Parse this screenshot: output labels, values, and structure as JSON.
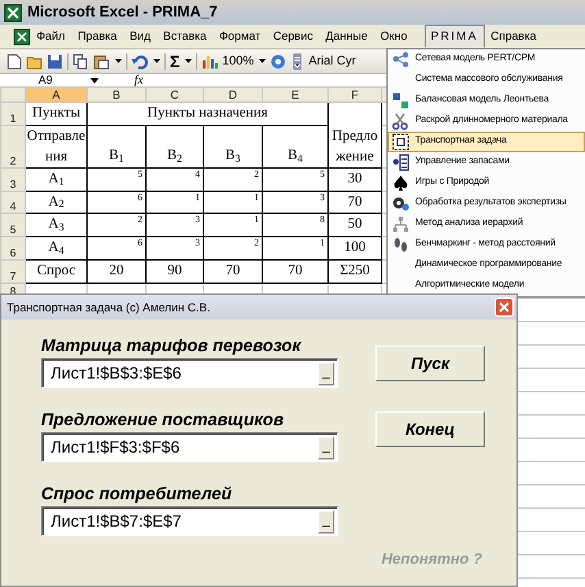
{
  "window": {
    "title": "Microsoft Excel - PRIMA_7"
  },
  "menu": [
    {
      "label": "Файл",
      "selected": false
    },
    {
      "label": "Правка",
      "selected": false
    },
    {
      "label": "Вид",
      "selected": false
    },
    {
      "label": "Вставка",
      "selected": false
    },
    {
      "label": "Формат",
      "selected": false
    },
    {
      "label": "Сервис",
      "selected": false
    },
    {
      "label": "Данные",
      "selected": false
    },
    {
      "label": "Окно",
      "selected": false
    },
    {
      "label": "PRIMA",
      "selected": true
    },
    {
      "label": "Справка",
      "selected": false
    }
  ],
  "toolbar": {
    "sum": "Σ",
    "zoom": "100%",
    "font": "Arial Cyr"
  },
  "formula_bar": {
    "cell": "A9",
    "fx": "fx"
  },
  "sheet": {
    "columns": [
      {
        "label": "A",
        "selected": true
      },
      {
        "label": "B",
        "selected": false
      },
      {
        "label": "C",
        "selected": false
      },
      {
        "label": "D",
        "selected": false
      },
      {
        "label": "E",
        "selected": false
      },
      {
        "label": "F",
        "selected": false
      }
    ],
    "row_numbers": [
      "1",
      "2",
      "3",
      "4",
      "5",
      "6",
      "7",
      "8"
    ],
    "corner_top": "Пункты",
    "corner_bottom": "Отправления",
    "destinations_title": "Пункты назначения",
    "supply_title": "Предложение",
    "destinations": [
      "B$_{1}$",
      "B$_{2}$",
      "B$_{3}$",
      "B$_{4}$"
    ],
    "sources": [
      {
        "name": "A$_{1}$",
        "costs": [
          "5",
          "4",
          "2",
          "5"
        ],
        "supply": "30"
      },
      {
        "name": "A$_{2}$",
        "costs": [
          "6",
          "1",
          "1",
          "3"
        ],
        "supply": "70"
      },
      {
        "name": "A$_{3}$",
        "costs": [
          "2",
          "3",
          "1",
          "8"
        ],
        "supply": "50"
      },
      {
        "name": "A$_{4}$",
        "costs": [
          "6",
          "3",
          "2",
          "1"
        ],
        "supply": "100"
      }
    ],
    "demand": {
      "label": "Спрос",
      "values": [
        "20",
        "90",
        "70",
        "70"
      ],
      "total": "Σ250"
    }
  },
  "prima_menu": {
    "items": [
      {
        "label": "Сетевая модель PERT/CPM",
        "selected": false
      },
      {
        "label": "Система массового обслуживания",
        "selected": false
      },
      {
        "label": "Балансовая модель Леонтьева",
        "selected": false
      },
      {
        "label": "Раскрой длинномерного материала",
        "selected": false
      },
      {
        "label": "Транспортная задача",
        "selected": true
      },
      {
        "label": "Управление запасами",
        "selected": false
      },
      {
        "label": "Игры с Природой",
        "selected": false
      },
      {
        "label": "Обработка результатов экспертизы",
        "selected": false
      },
      {
        "label": "Метод анализа иерархий",
        "selected": false
      },
      {
        "label": "Бенчмаркинг - метод расстояний",
        "selected": false
      },
      {
        "label": "Динамическое программирование",
        "selected": false
      },
      {
        "label": "Алгоритмические модели",
        "selected": false
      }
    ]
  },
  "dialog": {
    "title": "Транспортная задача (c) Амелин С.В.",
    "fields": [
      {
        "label": "Матрица тарифов перевозок",
        "value": "Лист1!$B$3:$E$6",
        "button": "_"
      },
      {
        "label": "Предложение поставщиков",
        "value": "Лист1!$F$3:$F$6",
        "button": "_"
      },
      {
        "label": "Спрос потребителей",
        "value": "Лист1!$B$7:$E$7",
        "button": "_"
      }
    ],
    "buttons": [
      "Пуск",
      "Конец"
    ],
    "help_link": "Непонятно ?"
  }
}
